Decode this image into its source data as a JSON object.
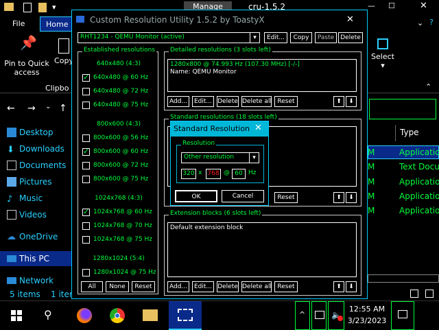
{
  "explorer": {
    "title_tab": "Manage",
    "title_text": "cru-1.5.2",
    "tabs": [
      "File",
      "Home"
    ],
    "ribbon": {
      "pin_label": "Pin to Quick access",
      "copy_label": "Copy",
      "clipboard_label": "Clipbo",
      "select_label": "Select"
    },
    "nav": [
      {
        "label": "Desktop"
      },
      {
        "label": "Downloads"
      },
      {
        "label": "Documents"
      },
      {
        "label": "Pictures"
      },
      {
        "label": "Music"
      },
      {
        "label": "Videos"
      },
      {
        "label": "OneDrive"
      },
      {
        "label": "This PC"
      },
      {
        "label": "Network"
      }
    ],
    "status_items": "5 items",
    "status_selected": "1 item",
    "type_header": "Type",
    "types": [
      "Application",
      "Text Document",
      "Application",
      "Application",
      "Application"
    ],
    "date_suffix": "M"
  },
  "cru": {
    "title": "Custom Resolution Utility 1.5.2 by ToastyX",
    "monitor": "RHT1234 - QEMU Monitor (active)",
    "top_buttons": {
      "edit": "Edit...",
      "copy": "Copy",
      "paste": "Paste",
      "delete": "Delete"
    },
    "established": {
      "label": "Established resolutions",
      "groups": [
        {
          "header": "640x480 (4:3)",
          "items": [
            {
              "label": "640x480 @ 60 Hz",
              "checked": true
            },
            {
              "label": "640x480 @ 72 Hz",
              "checked": false
            },
            {
              "label": "640x480 @ 75 Hz",
              "checked": false
            }
          ]
        },
        {
          "header": "800x600 (4:3)",
          "items": [
            {
              "label": "800x600 @ 56 Hz",
              "checked": false
            },
            {
              "label": "800x600 @ 60 Hz",
              "checked": true
            },
            {
              "label": "800x600 @ 72 Hz",
              "checked": false
            },
            {
              "label": "800x600 @ 75 Hz",
              "checked": false
            }
          ]
        },
        {
          "header": "1024x768 (4:3)",
          "items": [
            {
              "label": "1024x768 @ 60 Hz",
              "checked": true
            },
            {
              "label": "1024x768 @ 70 Hz",
              "checked": false
            },
            {
              "label": "1024x768 @ 75 Hz",
              "checked": false
            }
          ]
        },
        {
          "header": "1280x1024 (5:4)",
          "items": [
            {
              "label": "1280x1024 @ 75 Hz",
              "checked": false
            }
          ]
        }
      ],
      "buttons": {
        "all": "All",
        "none": "None",
        "reset": "Reset"
      }
    },
    "detailed": {
      "label": "Detailed resolutions (3 slots left)",
      "line1": "1280x800 @ 74.993 Hz (107.30 MHz) [-/-]",
      "line2": "Name: QEMU Monitor",
      "buttons": {
        "add": "Add...",
        "edit": "Edit...",
        "delete": "Delete",
        "delete_all": "Delete all",
        "reset": "Reset"
      }
    },
    "standard": {
      "label": "Standard resolutions (18 slots left)",
      "buttons": {
        "reset": "Reset"
      }
    },
    "extension": {
      "label": "Extension blocks (6 slots left)",
      "line1": "Default extension block",
      "buttons": {
        "add": "Add...",
        "edit": "Edit...",
        "delete": "Delete",
        "delete_all": "Delete all",
        "reset": "Reset"
      }
    },
    "arrows": {
      "up": "⬆",
      "down": "⬇"
    }
  },
  "modal": {
    "title": "Standard Resolution",
    "group_label": "Resolution",
    "select_value": "Other resolution",
    "width": "320",
    "x_sep": "x",
    "height": "768",
    "at_sep": "@",
    "refresh": "60",
    "hz": "Hz",
    "ok": "OK",
    "cancel": "Cancel"
  },
  "taskbar": {
    "time": "12:55 AM",
    "date": "3/23/2023"
  },
  "colors": {
    "accent": "#00d0ff",
    "green": "#00ff3c",
    "red": "#ff2020",
    "nav_blue": "#2ad0ff"
  }
}
